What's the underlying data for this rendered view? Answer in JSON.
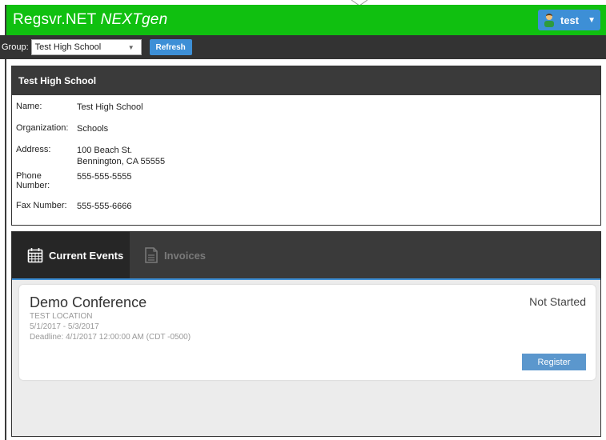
{
  "app": {
    "brand_main": "Regsvr.NET",
    "brand_accent": "NEXTgen",
    "header_color": "#10c010"
  },
  "user_menu": {
    "username": "test",
    "icon": "user-avatar-icon",
    "caret": "chevron-down-icon",
    "accent": "#3d8fd6"
  },
  "toolbar": {
    "group_label": "Group:",
    "group_selected": "Test High School",
    "refresh_label": "Refresh"
  },
  "organization": {
    "title": "Test High School",
    "fields": [
      {
        "label": "Name:",
        "lines": [
          "Test High School"
        ]
      },
      {
        "label": "Organization:",
        "lines": [
          "Schools"
        ]
      },
      {
        "label": "Address:",
        "lines": [
          "100 Beach St.",
          "Bennington, CA 55555"
        ]
      },
      {
        "label": "Phone Number:",
        "lines": [
          "555-555-5555"
        ]
      },
      {
        "label": "Fax Number:",
        "lines": [
          "555-555-6666"
        ]
      }
    ]
  },
  "tabs": [
    {
      "label": "Current Events",
      "icon": "calendar-icon",
      "active": true
    },
    {
      "label": "Invoices",
      "icon": "document-icon",
      "active": false
    }
  ],
  "events": [
    {
      "name": "Demo Conference",
      "status": "Not Started",
      "location": "TEST LOCATION",
      "dates": "5/1/2017 - 5/3/2017",
      "deadline": "Deadline: 4/1/2017 12:00:00 AM (CDT -0500)",
      "action_label": "Register"
    }
  ]
}
